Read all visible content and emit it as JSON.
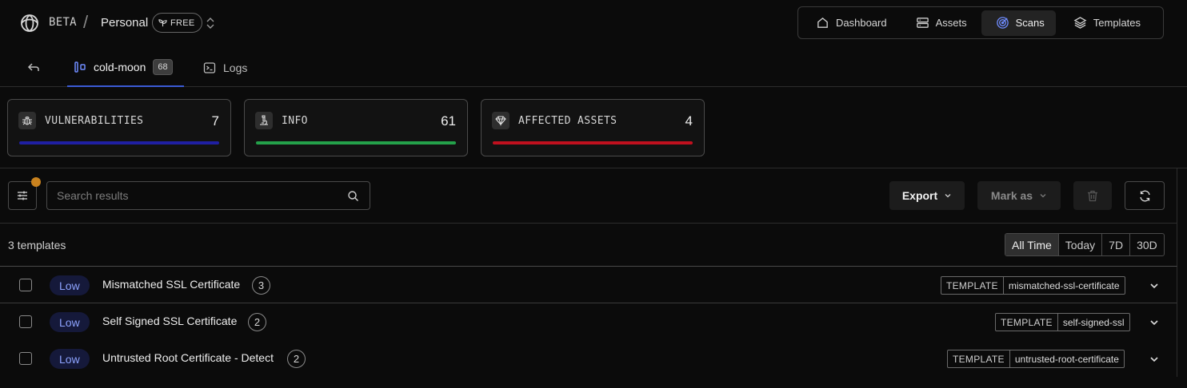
{
  "header": {
    "beta_label": "BETA",
    "separator": "/",
    "workspace": "Personal",
    "plan_badge": "FREE",
    "nav": [
      {
        "label": "Dashboard",
        "icon": "home-icon"
      },
      {
        "label": "Assets",
        "icon": "server-icon"
      },
      {
        "label": "Scans",
        "icon": "target-icon",
        "active": true
      },
      {
        "label": "Templates",
        "icon": "layers-icon"
      }
    ]
  },
  "tabs": {
    "scan_name": "cold-moon",
    "scan_count": "68",
    "logs_label": "Logs"
  },
  "stats": [
    {
      "label": "VULNERABILITIES",
      "value": "7",
      "color": "#1f1fa3",
      "icon": "bug-icon"
    },
    {
      "label": "INFO",
      "value": "61",
      "color": "#24a14a",
      "icon": "microscope-icon"
    },
    {
      "label": "AFFECTED ASSETS",
      "value": "4",
      "color": "#c0101e",
      "icon": "diamond-icon"
    }
  ],
  "toolbar": {
    "search_placeholder": "Search results",
    "export_label": "Export",
    "markas_label": "Mark as",
    "filter_dot_color": "#c9821e"
  },
  "results": {
    "count_label": "3 templates",
    "ranges": [
      "All Time",
      "Today",
      "7D",
      "30D"
    ],
    "selected_range": "All Time",
    "rows": [
      {
        "severity": "Low",
        "name": "Mismatched SSL Certificate",
        "count": "3",
        "template_key": "TEMPLATE",
        "template_id": "mismatched-ssl-certificate"
      },
      {
        "severity": "Low",
        "name": "Self Signed SSL Certificate",
        "count": "2",
        "template_key": "TEMPLATE",
        "template_id": "self-signed-ssl"
      },
      {
        "severity": "Low",
        "name": "Untrusted Root Certificate - Detect",
        "count": "2",
        "template_key": "TEMPLATE",
        "template_id": "untrusted-root-certificate"
      }
    ]
  },
  "colors": {
    "accent": "#3b5bd6",
    "severity_low_text": "#8ea4ff",
    "severity_low_bg": "#15193a"
  }
}
